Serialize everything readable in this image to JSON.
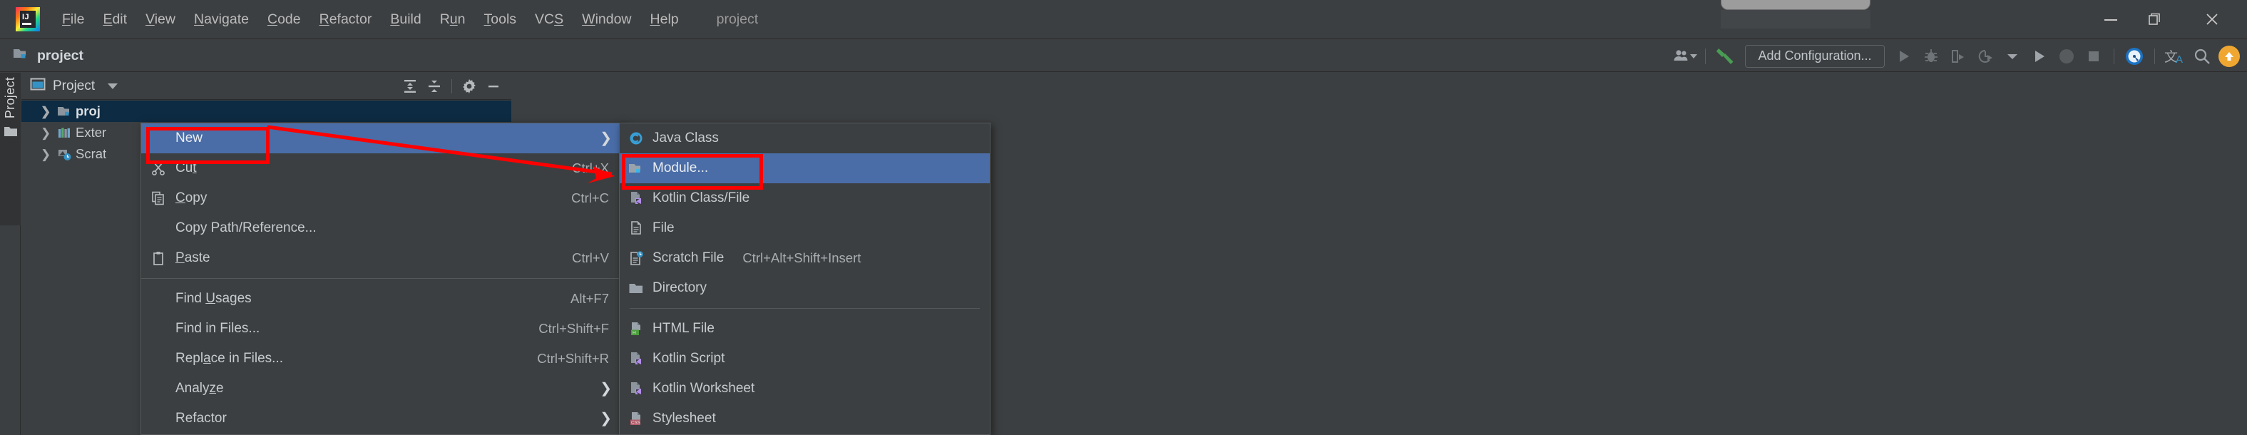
{
  "app": {
    "logo": "intellij-idea-logo",
    "window_title": "project"
  },
  "menubar": {
    "items": [
      {
        "label": "File",
        "mnemonic": "F"
      },
      {
        "label": "Edit",
        "mnemonic": "E"
      },
      {
        "label": "View",
        "mnemonic": "V"
      },
      {
        "label": "Navigate",
        "mnemonic": "N"
      },
      {
        "label": "Code",
        "mnemonic": "C"
      },
      {
        "label": "Refactor",
        "mnemonic": "R"
      },
      {
        "label": "Build",
        "mnemonic": "B"
      },
      {
        "label": "Run",
        "mnemonic": "u"
      },
      {
        "label": "Tools",
        "mnemonic": "T"
      },
      {
        "label": "VCS",
        "mnemonic": "S"
      },
      {
        "label": "Window",
        "mnemonic": "W"
      },
      {
        "label": "Help",
        "mnemonic": "H"
      }
    ],
    "project_label": "project"
  },
  "window_controls": {
    "minimize": "minimize-icon",
    "restore": "restore-icon",
    "close": "close-icon"
  },
  "navbar": {
    "breadcrumb": "project",
    "breadcrumb_icon": "module-folder-icon"
  },
  "toolbar": {
    "add_configuration_label": "Add Configuration...",
    "buttons": [
      {
        "name": "user-account-icon",
        "title": "Account"
      },
      {
        "name": "build-hammer-icon",
        "title": "Build"
      },
      {
        "name": "run-icon",
        "title": "Run"
      },
      {
        "name": "debug-icon",
        "title": "Debug"
      },
      {
        "name": "run-with-coverage-icon",
        "title": "Run with Coverage"
      },
      {
        "name": "profiler-icon",
        "title": "Profiler"
      },
      {
        "name": "chevron-down-icon",
        "title": "More"
      },
      {
        "name": "run-anything-icon",
        "title": "Run Anything"
      },
      {
        "name": "stop-circle-icon",
        "title": "Stop"
      },
      {
        "name": "stop-square-icon",
        "title": "Stop"
      },
      {
        "name": "inspection-icon",
        "title": "Inspection"
      },
      {
        "name": "translate-icon",
        "title": "Translate"
      },
      {
        "name": "search-everywhere-icon",
        "title": "Search Everywhere"
      },
      {
        "name": "update-project-icon",
        "title": "Update"
      }
    ]
  },
  "toolwindow_strip": {
    "tab_label": "Project",
    "folder_icon": "folder-icon"
  },
  "project_panel": {
    "title": "Project",
    "dropdown_icon": "chevron-down-icon",
    "header_actions": [
      {
        "name": "expand-all-icon"
      },
      {
        "name": "collapse-all-icon"
      },
      {
        "name": "settings-gear-icon"
      },
      {
        "name": "hide-minimize-icon"
      }
    ],
    "tree": [
      {
        "label": "proj",
        "icon": "module-folder-icon",
        "expander": "chevron-right-icon",
        "selected": true
      },
      {
        "label": "Exter",
        "icon": "external-libraries-icon",
        "expander": "chevron-right-icon",
        "selected": false
      },
      {
        "label": "Scrat",
        "icon": "scratches-icon",
        "expander": "chevron-right-icon",
        "selected": false
      }
    ]
  },
  "context_menu": {
    "items": [
      {
        "label": "New",
        "shortcut": "",
        "icon": "",
        "submenu": true,
        "highlighted": true,
        "separator_after": false
      },
      {
        "label": "Cut",
        "shortcut": "Ctrl+X",
        "icon": "cut-scissors-icon",
        "submenu": false,
        "highlighted": false,
        "separator_after": false
      },
      {
        "label": "Copy",
        "shortcut": "Ctrl+C",
        "icon": "copy-icon",
        "submenu": false,
        "highlighted": false,
        "separator_after": false
      },
      {
        "label": "Copy Path/Reference...",
        "shortcut": "",
        "icon": "",
        "submenu": false,
        "highlighted": false,
        "separator_after": false
      },
      {
        "label": "Paste",
        "shortcut": "Ctrl+V",
        "icon": "paste-clipboard-icon",
        "submenu": false,
        "highlighted": false,
        "separator_after": true
      },
      {
        "label": "Find Usages",
        "shortcut": "Alt+F7",
        "icon": "",
        "submenu": false,
        "highlighted": false,
        "separator_after": false
      },
      {
        "label": "Find in Files...",
        "shortcut": "Ctrl+Shift+F",
        "icon": "",
        "submenu": false,
        "highlighted": false,
        "separator_after": false
      },
      {
        "label": "Replace in Files...",
        "shortcut": "Ctrl+Shift+R",
        "icon": "",
        "submenu": false,
        "highlighted": false,
        "separator_after": false
      },
      {
        "label": "Analyze",
        "shortcut": "",
        "icon": "",
        "submenu": true,
        "highlighted": false,
        "separator_after": false
      },
      {
        "label": "Refactor",
        "shortcut": "",
        "icon": "",
        "submenu": true,
        "highlighted": false,
        "separator_after": false
      }
    ]
  },
  "submenu": {
    "items": [
      {
        "label": "Java Class",
        "shortcut": "",
        "icon": "java-class-icon",
        "highlighted": false,
        "separator_after": false
      },
      {
        "label": "Module...",
        "shortcut": "",
        "icon": "module-folder-icon",
        "highlighted": true,
        "separator_after": false
      },
      {
        "label": "Kotlin Class/File",
        "shortcut": "",
        "icon": "kotlin-file-icon",
        "highlighted": false,
        "separator_after": false
      },
      {
        "label": "File",
        "shortcut": "",
        "icon": "file-icon",
        "highlighted": false,
        "separator_after": false
      },
      {
        "label": "Scratch File",
        "shortcut": "Ctrl+Alt+Shift+Insert",
        "icon": "scratch-file-icon",
        "highlighted": false,
        "separator_after": false
      },
      {
        "label": "Directory",
        "shortcut": "",
        "icon": "folder-icon",
        "highlighted": false,
        "separator_after": true
      },
      {
        "label": "HTML File",
        "shortcut": "",
        "icon": "html-file-icon",
        "highlighted": false,
        "separator_after": false
      },
      {
        "label": "Kotlin Script",
        "shortcut": "",
        "icon": "kotlin-file-icon",
        "highlighted": false,
        "separator_after": false
      },
      {
        "label": "Kotlin Worksheet",
        "shortcut": "",
        "icon": "kotlin-file-icon",
        "highlighted": false,
        "separator_after": false
      },
      {
        "label": "Stylesheet",
        "shortcut": "",
        "icon": "css-file-icon",
        "highlighted": false,
        "separator_after": false
      }
    ]
  },
  "annotations": {
    "highlight_color": "#FF0000",
    "boxes": [
      {
        "name": "new-menu-item-highlight-box"
      },
      {
        "name": "module-submenu-item-highlight-box"
      }
    ],
    "arrow": {
      "name": "pointer-arrow",
      "from": "New",
      "to": "Module..."
    }
  },
  "colors": {
    "background": "#3C3F41",
    "menu_highlight": "#4A6DA7",
    "tree_selection": "#0D2B42",
    "accent_orange": "#F0A732",
    "accent_green": "#499C54"
  }
}
